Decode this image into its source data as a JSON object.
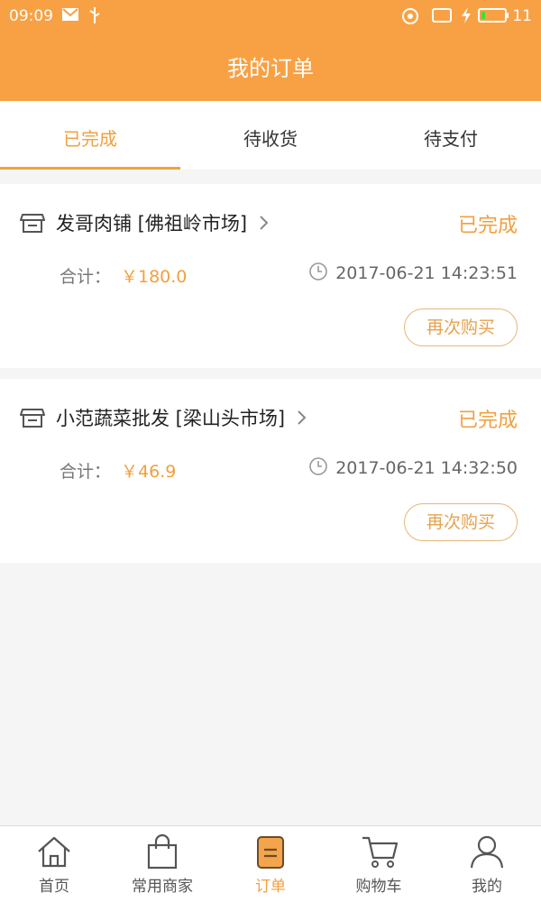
{
  "status_bar": {
    "time": "09:09",
    "battery": "11"
  },
  "header": {
    "title": "我的订单"
  },
  "tabs": [
    {
      "label": "已完成",
      "active": true
    },
    {
      "label": "待收货",
      "active": false
    },
    {
      "label": "待支付",
      "active": false
    }
  ],
  "orders": [
    {
      "store": "发哥肉铺 [佛祖岭市场]",
      "status": "已完成",
      "total_label": "合计：",
      "total": "￥180.0",
      "time": "2017-06-21 14:23:51",
      "action": "再次购买"
    },
    {
      "store": "小范蔬菜批发 [梁山头市场]",
      "status": "已完成",
      "total_label": "合计：",
      "total": "￥46.9",
      "time": "2017-06-21 14:32:50",
      "action": "再次购买"
    }
  ],
  "bottom_nav": [
    {
      "label": "首页",
      "icon": "home-icon"
    },
    {
      "label": "常用商家",
      "icon": "bag-icon"
    },
    {
      "label": "订单",
      "icon": "order-icon",
      "active": true
    },
    {
      "label": "购物车",
      "icon": "cart-icon"
    },
    {
      "label": "我的",
      "icon": "user-icon"
    }
  ],
  "colors": {
    "accent": "#f8a144",
    "text_accent": "#f2a03d"
  }
}
